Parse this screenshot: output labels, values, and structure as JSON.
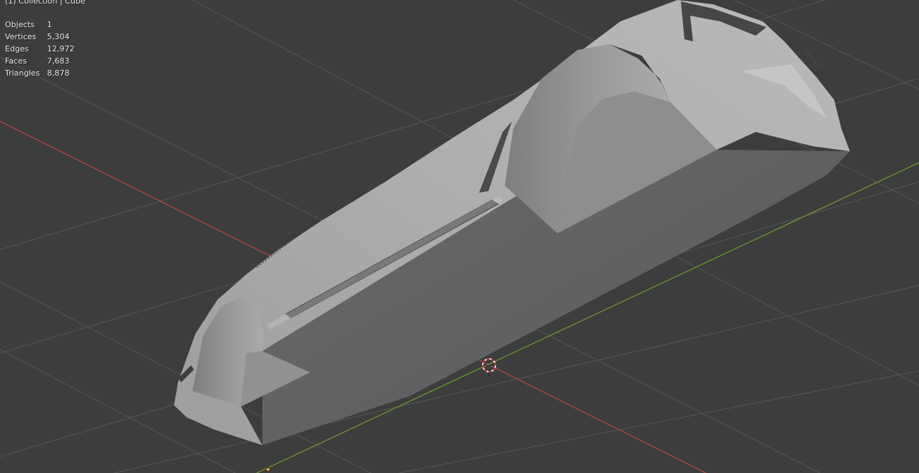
{
  "viewport": {
    "header_text": "(1) Collection | Cube",
    "background_color": "#3d3d3d",
    "grid_color": "#555555",
    "x_axis_color": "#b5454f",
    "y_axis_color": "#6f9a2e",
    "stats": [
      {
        "label": "Objects",
        "value": "1"
      },
      {
        "label": "Vertices",
        "value": "5,304"
      },
      {
        "label": "Edges",
        "value": "12,972"
      },
      {
        "label": "Faces",
        "value": "7,683"
      },
      {
        "label": "Triangles",
        "value": "8,878"
      }
    ]
  },
  "scene": {
    "icons": [
      "3d-cursor-icon",
      "origin-point-icon"
    ],
    "model_color": "#a6a8a9",
    "model_side_color": "#5e5f60"
  }
}
